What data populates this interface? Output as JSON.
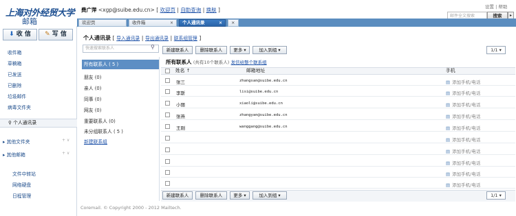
{
  "header": {
    "logo_top": "上海对外经贸大学",
    "logo_bottom": "邮箱",
    "user_name": "费广萍",
    "user_email": "<xgp@suibe.edu.cn>",
    "links": [
      "欢迎页",
      "自助查询",
      "换肤"
    ],
    "settings": "设置",
    "help": "帮助",
    "search_placeholder": "邮件全文搜索",
    "search_button": "搜索"
  },
  "tabs": [
    {
      "label": "欢迎页",
      "closable": false
    },
    {
      "label": "收件箱",
      "closable": true
    },
    {
      "label": "个人通讯录",
      "closable": true
    }
  ],
  "sidebar": {
    "receive_button": "收 信",
    "compose_button": "写 信",
    "folders": [
      "收件箱",
      "草稿箱",
      "已发送",
      "已删除",
      "垃圾邮件",
      "病毒文件夹"
    ],
    "contacts_link": "个人通讯录",
    "other_folders": "其他文件夹",
    "other_mail": "其他邮箱",
    "tools": [
      "文件中转站",
      "网络硬盘",
      "日程管理"
    ]
  },
  "main": {
    "title": "个人通讯录",
    "actions": [
      "导入通讯录",
      "导出通讯录",
      "联系组管理"
    ],
    "search_placeholder": "快速搜索联系人",
    "toolbar": [
      "新建联系人",
      "删除联系人",
      "更多",
      "加入到组"
    ],
    "pager": "1/1"
  },
  "groups": {
    "selected": "所有联系人 ( 5 )",
    "items": [
      "朋友 (0)",
      "亲人 (0)",
      "同事 (0)",
      "网友 (0)",
      "重要联系人 (0)",
      "未分组联系人 ( 5 )"
    ],
    "new_group": "新建联系组"
  },
  "list": {
    "title": "所有联系人",
    "subtitle": "(共有10个联系人)",
    "send_link": "发信给整个联系组",
    "columns": {
      "name": "姓名",
      "email": "邮箱地址",
      "phone": "手机"
    },
    "rows": [
      {
        "name": "张三",
        "email": "zhangsan@suibe.edu.cn",
        "phone": "添加手机/电话"
      },
      {
        "name": "李斯",
        "email": "lisi@suibe.edu.cn",
        "phone": "添加手机/电话"
      },
      {
        "name": "小丽",
        "email": "xiaoli@suibe.edu.cn",
        "phone": "添加手机/电话"
      },
      {
        "name": "张燕",
        "email": "zhangyan@suibe.edu.cn",
        "phone": "添加手机/电话"
      },
      {
        "name": "王刚",
        "email": "wanggang@suibe.edu.cn",
        "phone": "添加手机/电话"
      },
      {
        "name": "",
        "email": "",
        "phone": "添加手机/电话"
      },
      {
        "name": "",
        "email": "",
        "phone": "添加手机/电话"
      },
      {
        "name": "",
        "email": "",
        "phone": "添加手机/电话"
      },
      {
        "name": "",
        "email": "",
        "phone": "添加手机/电话"
      },
      {
        "name": "",
        "email": "",
        "phone": "添加手机/电话"
      }
    ]
  },
  "footer": {
    "copyright": "Coremail. © Copyright 2000 - 2012 Mailtech."
  }
}
